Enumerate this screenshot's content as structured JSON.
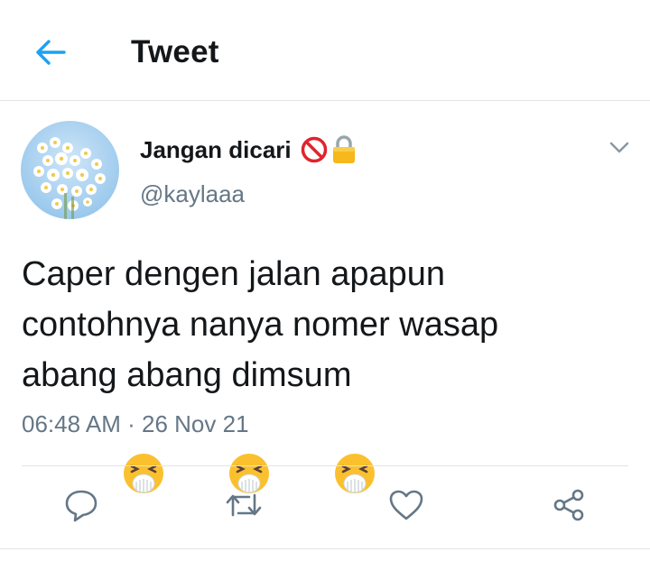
{
  "header": {
    "title": "Tweet",
    "back_icon": "arrow-left-icon"
  },
  "tweet": {
    "author_name": "Jangan dicari",
    "handle": "@kaylaaa",
    "text_lines": [
      "Caper dengen jalan apapun",
      "contohnya nanya nomer wasap",
      "abang abang dimsum"
    ],
    "emojis": [
      "sneezing-face-emoji",
      "sneezing-face-emoji",
      "sneezing-face-emoji"
    ],
    "badges": [
      "no-entry-icon",
      "lock-icon"
    ],
    "time": "06:48 AM",
    "separator": "·",
    "date": "26 Nov 21"
  },
  "actions": [
    "reply-icon",
    "retweet-icon",
    "like-icon",
    "share-icon"
  ],
  "colors": {
    "accent": "#1da1f2",
    "text": "#14171a",
    "secondary": "#657786",
    "divider": "#e1e4e6"
  }
}
